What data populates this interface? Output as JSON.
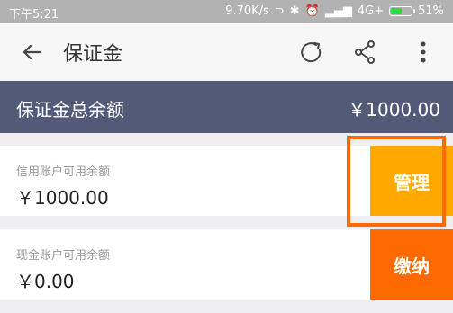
{
  "status_bar": {
    "time": "下午5:21",
    "network_speed": "9.70K/s",
    "network_type": "4G+",
    "battery": "51%",
    "battery_level": 0.51,
    "icons": [
      "headset-icon",
      "bluetooth-icon",
      "alarm-icon",
      "signal-icon",
      "wifi-icon",
      "signal2-icon"
    ]
  },
  "app_bar": {
    "back_icon": "back-arrow-icon",
    "title": "保证金",
    "refresh_icon": "refresh-icon",
    "share_icon": "share-icon",
    "more_icon": "more-vertical-icon"
  },
  "summary": {
    "label": "保证金总余额",
    "amount": "￥1000.00"
  },
  "accounts": [
    {
      "label": "信用账户可用余额",
      "value": "￥1000.00",
      "action": "管理",
      "color": "#ffa800"
    },
    {
      "label": "现金账户可用余额",
      "value": "￥0.00",
      "action": "缴纳",
      "color": "#ff6a00"
    }
  ],
  "colors": {
    "summary_bg": "#525a78",
    "highlight": "#ff6a00"
  }
}
